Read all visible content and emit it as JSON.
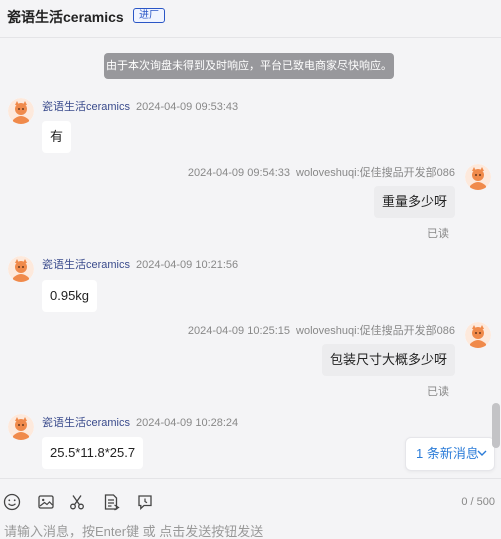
{
  "header": {
    "shop_name": "瓷语生活ceramics",
    "badge": "进厂"
  },
  "system_notice": "由于本次询盘未得到及时响应，平台已致电商家尽快响应。",
  "messages": [
    {
      "sender": "瓷语生活ceramics",
      "time": "2024-04-09 09:53:43",
      "text": "有",
      "side": "left"
    },
    {
      "sender": "woloveshuqi:促佳搜品开发部086",
      "time": "2024-04-09 09:54:33",
      "text": "重量多少呀",
      "side": "right",
      "status": "已读"
    },
    {
      "sender": "瓷语生活ceramics",
      "time": "2024-04-09 10:21:56",
      "text": "0.95kg",
      "side": "left"
    },
    {
      "sender": "woloveshuqi:促佳搜品开发部086",
      "time": "2024-04-09 10:25:15",
      "text": "包装尺寸大概多少呀",
      "side": "right",
      "status": "已读"
    },
    {
      "sender": "瓷语生活ceramics",
      "time": "2024-04-09 10:28:24",
      "text": "25.5*11.8*25.7",
      "side": "left"
    }
  ],
  "new_messages_label": "1 条新消息",
  "toolbar": {
    "icons": [
      "emoji-icon",
      "image-icon",
      "scissors-icon",
      "document-icon",
      "history-icon"
    ]
  },
  "composer": {
    "counter": "0 / 500",
    "placeholder": "请输入消息，按Enter键 或 点击发送按钮发送"
  },
  "colors": {
    "accent": "#2b7cd8",
    "avatar": "#f08a4b"
  }
}
